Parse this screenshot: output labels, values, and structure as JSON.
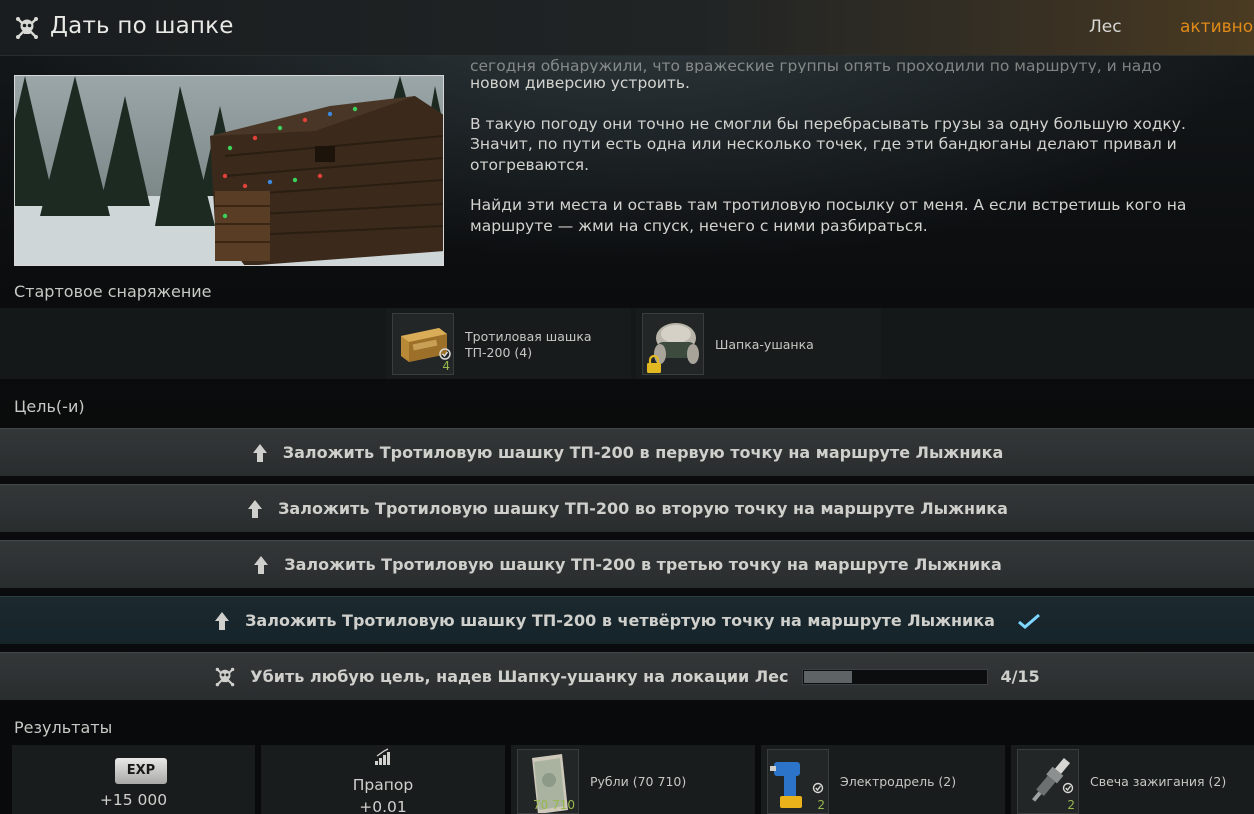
{
  "header": {
    "title": "Дать по шапке",
    "location": "Лес",
    "status": "активно!",
    "icon": "skull-icon"
  },
  "description": {
    "partial_line": "сегодня обнаружили, что вражеские группы опять проходили по маршруту, и надо",
    "line1": "новом диверсию устроить.",
    "paragraph2": "В такую погоду они точно не смогли бы перебрасывать грузы за одну большую ходку. Значит, по пути есть одна или несколько точек, где эти бандюганы делают привал и отогреваются.",
    "paragraph3": "Найди эти места и оставь там тротиловую посылку от меня. А если встретишь кого на маршруте — жми на спуск, нечего с ними разбираться."
  },
  "starting_gear": {
    "label": "Стартовое снаряжение",
    "items": [
      {
        "name": "Тротиловая шашка ТП-200 (4)",
        "count": "4",
        "icon": "tnt-block-icon"
      },
      {
        "name": "Шапка-ушанка",
        "icon": "ushanka-hat-icon",
        "locked": true
      }
    ]
  },
  "objectives": {
    "label": "Цель(-и)",
    "items": [
      {
        "text": "Заложить Тротиловую шашку ТП-200 в первую точку на маршруте Лыжника",
        "icon": "arrow-up-icon",
        "completed": false
      },
      {
        "text": "Заложить Тротиловую шашку ТП-200 во вторую точку на маршруте Лыжника",
        "icon": "arrow-up-icon",
        "completed": false
      },
      {
        "text": "Заложить Тротиловую шашку ТП-200 в третью точку на маршруте Лыжника",
        "icon": "arrow-up-icon",
        "completed": false
      },
      {
        "text": "Заложить Тротиловую шашку ТП-200 в четвёртую точку на маршруте Лыжника",
        "icon": "arrow-up-icon",
        "completed": true
      },
      {
        "text": "Убить любую цель, надев Шапку-ушанку на локации Лес",
        "icon": "skull-icon",
        "progress_text": "4/15",
        "progress_current": 4,
        "progress_total": 15
      }
    ]
  },
  "results": {
    "label": "Результаты",
    "items": [
      {
        "badge": "EXP",
        "value": "+15 000"
      },
      {
        "title": "Прапор",
        "value": "+0.01",
        "icon": "reputation-bars-icon"
      },
      {
        "name": "Рубли (70 710)",
        "count": "70 710",
        "icon": "roubles-icon"
      },
      {
        "name": "Электродрель (2)",
        "count": "2",
        "icon": "drill-icon"
      },
      {
        "name": "Свеча зажигания (2)",
        "count": "2",
        "icon": "spark-plug-icon"
      }
    ]
  },
  "colors": {
    "accent_status": "#e08a18",
    "count_green": "#97b84d",
    "check_cyan": "#7fd6ff"
  }
}
